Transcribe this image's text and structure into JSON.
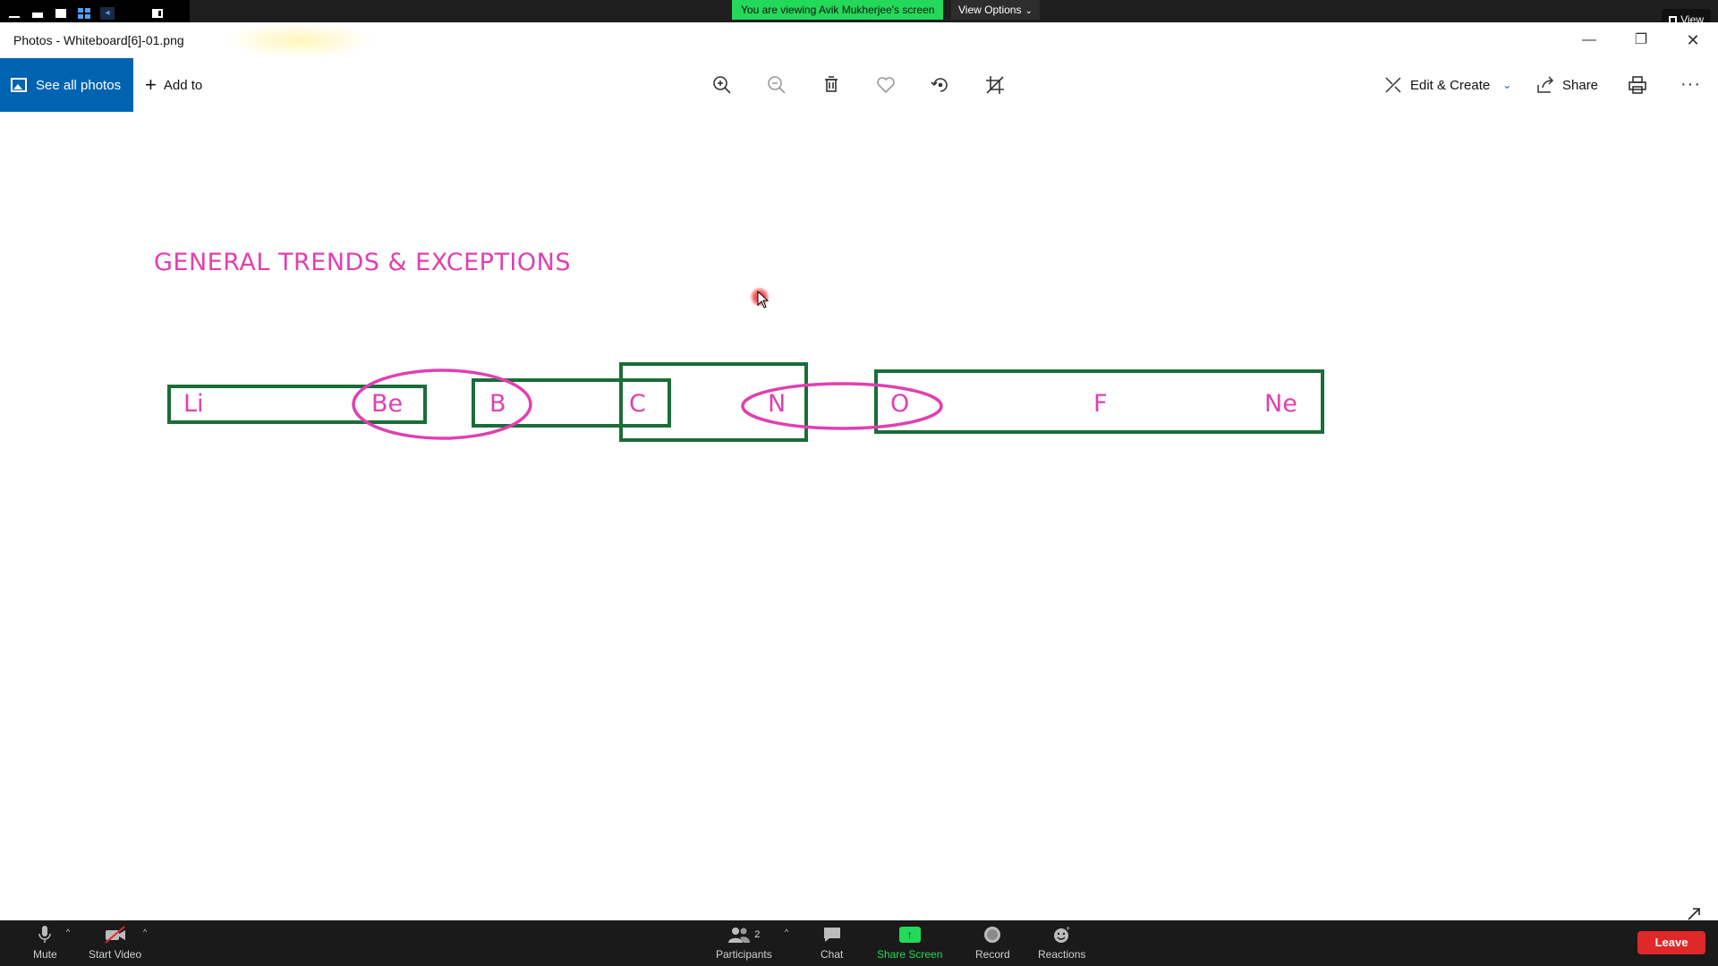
{
  "zoom": {
    "banner": "You are viewing Avik Mukherjee's screen",
    "view_options": "View Options",
    "view_button": "View",
    "bottom": {
      "mute": "Mute",
      "start_video": "Start Video",
      "participants": "Participants",
      "participants_count": "2",
      "chat": "Chat",
      "share_screen": "Share Screen",
      "record": "Record",
      "reactions": "Reactions",
      "leave": "Leave"
    }
  },
  "window": {
    "title": "Photos - Whiteboard[6]-01.png"
  },
  "toolbar": {
    "see_all_photos": "See all photos",
    "add_to": "Add to",
    "edit_create": "Edit & Create",
    "share": "Share",
    "icons": [
      "zoom-in-icon",
      "zoom-out-icon",
      "delete-icon",
      "favorite-icon",
      "rotate-icon",
      "crop-icon",
      "print-icon",
      "more-icon"
    ]
  },
  "whiteboard": {
    "title": "GENERAL TRENDS & EXCEPTIONS",
    "elements": [
      "Li",
      "Be",
      "B",
      "C",
      "N",
      "O",
      "F",
      "Ne"
    ],
    "colors": {
      "text": "#e040b0",
      "box": "#1a6e38",
      "ellipse": "#e040b0"
    }
  }
}
